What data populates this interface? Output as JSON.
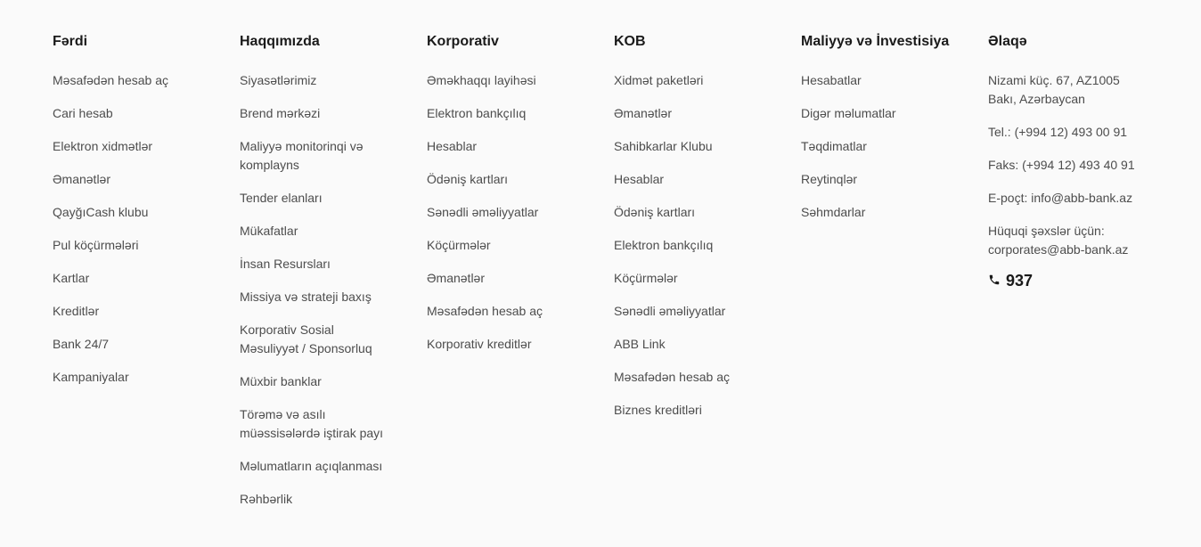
{
  "columns": [
    {
      "title": "Fərdi",
      "links": [
        "Məsafədən hesab aç",
        "Cari hesab",
        "Elektron xidmətlər",
        "Əmanətlər",
        "QayğıCash klubu",
        "Pul köçürmələri",
        "Kartlar",
        "Kreditlər",
        "Bank 24/7",
        "Kampaniyalar"
      ]
    },
    {
      "title": "Haqqımızda",
      "links": [
        "Siyasətlərimiz",
        "Brend mərkəzi",
        "Maliyyə monitorinqi və komplayns",
        "Tender elanları",
        "Mükafatlar",
        "İnsan Resursları",
        "Missiya və strateji baxış",
        "Korporativ Sosial Məsuliyyət / Sponsorluq",
        "Müxbir banklar",
        "Törəmə və asılı müəssisələrdə iştirak payı",
        "Məlumatların açıqlanması",
        "Rəhbərlik"
      ]
    },
    {
      "title": "Korporativ",
      "links": [
        "Əməkhaqqı layihəsi",
        "Elektron bankçılıq",
        "Hesablar",
        "Ödəniş kartları",
        "Sənədli əməliyyatlar",
        "Köçürmələr",
        "Əmanətlər",
        "Məsafədən hesab aç",
        "Korporativ kreditlər"
      ]
    },
    {
      "title": "KOB",
      "links": [
        "Xidmət paketləri",
        "Əmanətlər",
        "Sahibkarlar Klubu",
        "Hesablar",
        "Ödəniş kartları",
        "Elektron bankçılıq",
        "Köçürmələr",
        "Sənədli əməliyyatlar",
        "ABB Link",
        "Məsafədən hesab aç",
        "Biznes kreditləri"
      ]
    },
    {
      "title": "Maliyyə və İnvestisiya",
      "links": [
        "Hesabatlar",
        "Digər məlumatlar",
        "Təqdimatlar",
        "Reytinqlər",
        "Səhmdarlar"
      ]
    }
  ],
  "contact": {
    "title": "Əlaqə",
    "address": "Nizami küç. 67, AZ1005 Bakı, Azərbaycan",
    "tel": "Tel.: (+994 12) 493 00 91",
    "fax": "Faks: (+994 12) 493 40 91",
    "email": "E-poçt: info@abb-bank.az",
    "legal": "Hüquqi şəxslər üçün: corporates@abb-bank.az",
    "phone_short": "937",
    "phone_icon": "phone-icon"
  }
}
